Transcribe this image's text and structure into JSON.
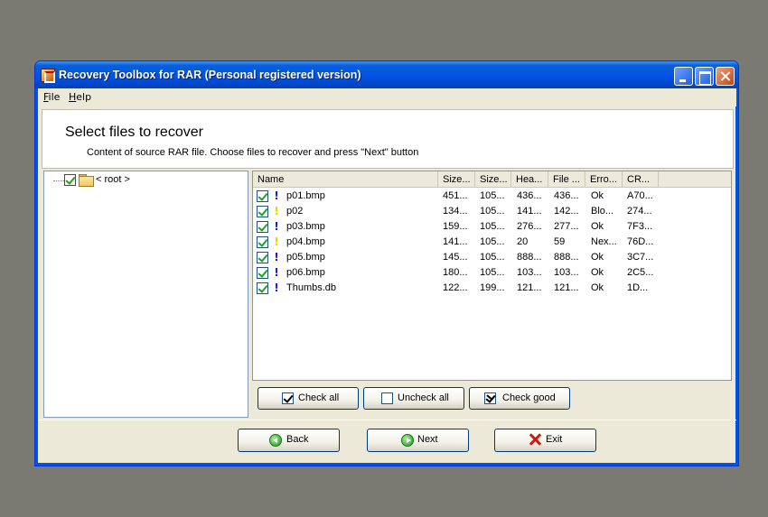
{
  "window": {
    "title": "Recovery Toolbox for RAR (Personal registered version)"
  },
  "menu": [
    {
      "hot": "F",
      "rest": "ile"
    },
    {
      "hot": "H",
      "rest": "elp"
    }
  ],
  "header": {
    "title": "Select files to recover",
    "subtitle": "Content of source RAR file. Choose files to recover and press \"Next\" button"
  },
  "tree": {
    "root_label": "< root >",
    "root_checked": true
  },
  "columns": [
    "Name",
    "Size...",
    "Size...",
    "Hea...",
    "File ...",
    "Erro...",
    "CR..."
  ],
  "files": [
    {
      "name": "p01.bmp",
      "checked": true,
      "status": "info",
      "c1": "451...",
      "c2": "105...",
      "c3": "436...",
      "c4": "436...",
      "c5": "Ok",
      "c6": "A70..."
    },
    {
      "name": "p02",
      "checked": true,
      "status": "warn",
      "c1": "134...",
      "c2": "105...",
      "c3": "141...",
      "c4": "142...",
      "c5": "Blo...",
      "c6": "274..."
    },
    {
      "name": "p03.bmp",
      "checked": true,
      "status": "info",
      "c1": "159...",
      "c2": "105...",
      "c3": "276...",
      "c4": "277...",
      "c5": "Ok",
      "c6": "7F3..."
    },
    {
      "name": "p04.bmp",
      "checked": true,
      "status": "warn",
      "c1": "141...",
      "c2": "105...",
      "c3": "20",
      "c4": "59",
      "c5": "Nex...",
      "c6": "76D..."
    },
    {
      "name": "p05.bmp",
      "checked": true,
      "status": "info",
      "c1": "145...",
      "c2": "105...",
      "c3": "888...",
      "c4": "888...",
      "c5": "Ok",
      "c6": "3C7..."
    },
    {
      "name": "p06.bmp",
      "checked": true,
      "status": "info",
      "c1": "180...",
      "c2": "105...",
      "c3": "103...",
      "c4": "103...",
      "c5": "Ok",
      "c6": "2C5..."
    },
    {
      "name": "Thumbs.db",
      "checked": true,
      "status": "info",
      "c1": "122...",
      "c2": "199...",
      "c3": "121...",
      "c4": "121...",
      "c5": "Ok",
      "c6": "1D..."
    }
  ],
  "list_buttons": {
    "check_all": "Check all",
    "uncheck_all": "Uncheck all",
    "check_good": "Check good"
  },
  "nav": {
    "back": "Back",
    "next": "Next",
    "exit": "Exit"
  },
  "icons": {
    "info": "!",
    "warn": "!"
  },
  "colors": {
    "titlebar": "#0055e5",
    "face": "#ece9d8",
    "info": "#1a1ae0",
    "warn": "#f0d000",
    "exit": "#d01a10",
    "nav_arrow": "#1f9a1f"
  }
}
